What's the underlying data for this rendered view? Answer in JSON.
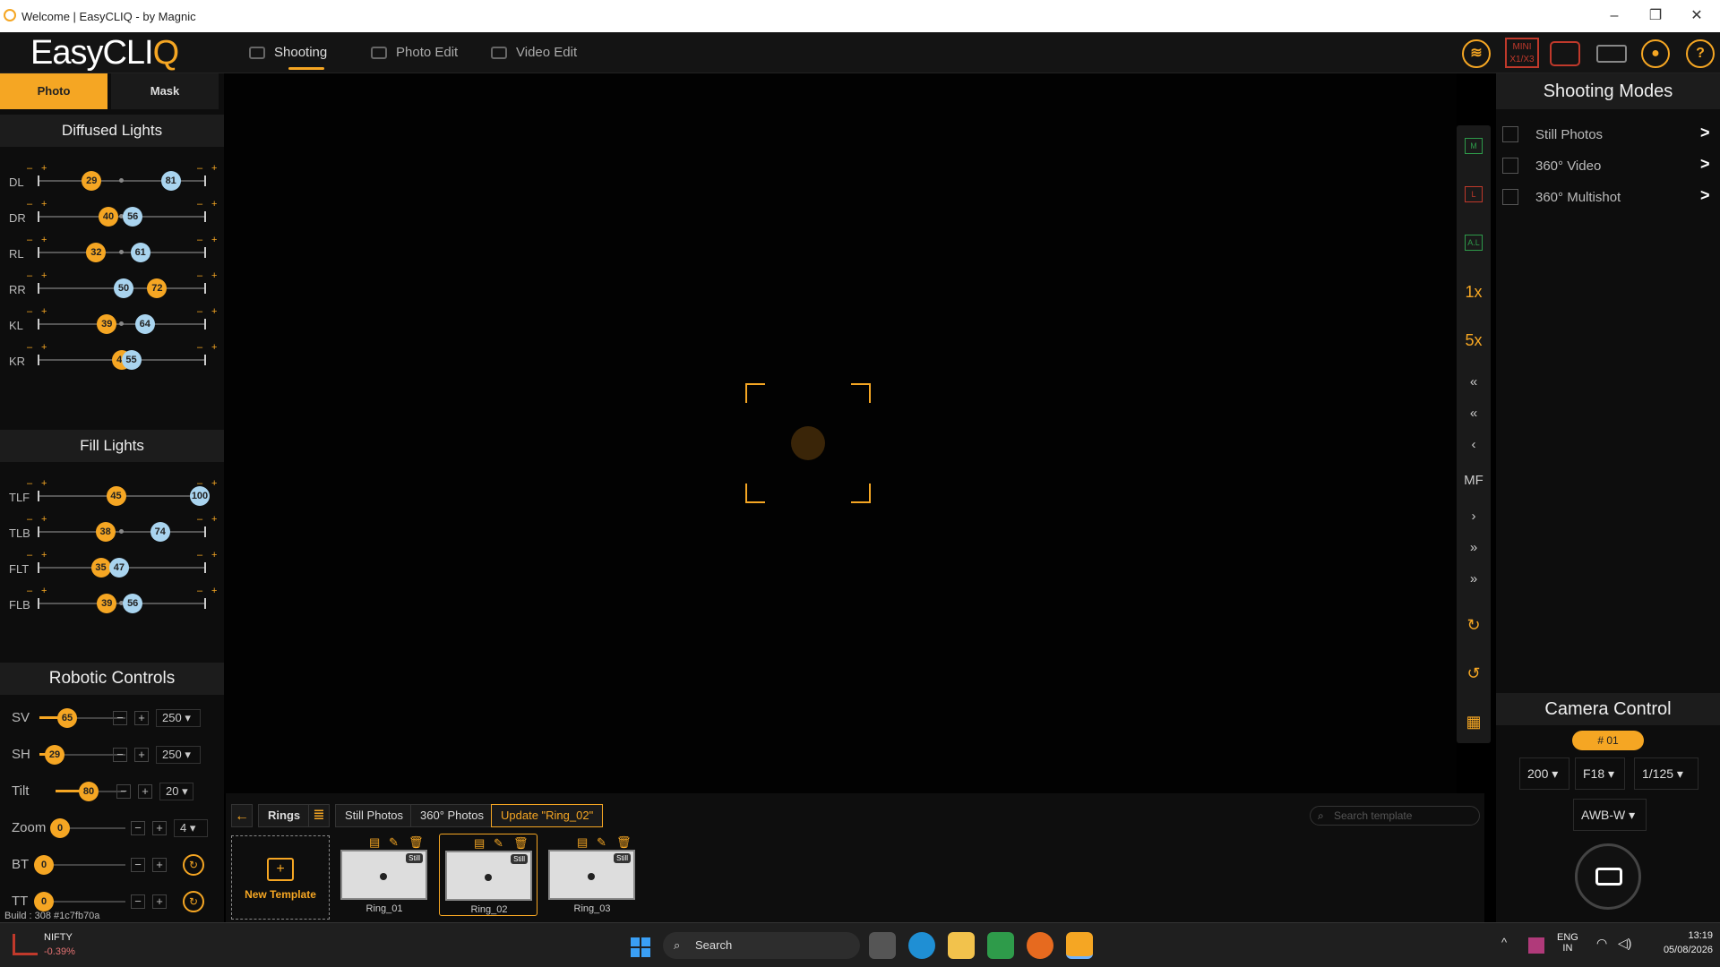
{
  "window": {
    "title": "Welcome | EasyCLIQ - by Magnic",
    "minimize": "–",
    "maximize": "❐",
    "close": "✕"
  },
  "app": {
    "brand_main": "EasyCLI",
    "brand_accent": "Q",
    "tabs": [
      {
        "label": "Shooting"
      },
      {
        "label": "Photo Edit"
      },
      {
        "label": "Video Edit"
      }
    ],
    "top_icons": {
      "device": "MINI X1/X3",
      "help": "?"
    }
  },
  "left": {
    "tabs": {
      "photo": "Photo",
      "mask": "Mask"
    },
    "diffused_title": "Diffused Lights",
    "diffused": [
      {
        "label": "DL",
        "a": 29,
        "b": 81
      },
      {
        "label": "DR",
        "a": 40,
        "b": 56
      },
      {
        "label": "RL",
        "a": 32,
        "b": 61
      },
      {
        "label": "RR",
        "a": 72,
        "b": 50
      },
      {
        "label": "KL",
        "a": 39,
        "b": 64
      },
      {
        "label": "KR",
        "a": 49,
        "b": 55
      }
    ],
    "fill_title": "Fill Lights",
    "fill": [
      {
        "label": "TLF",
        "a": 45,
        "b": 100
      },
      {
        "label": "TLB",
        "a": 38,
        "b": 74
      },
      {
        "label": "FLT",
        "a": 35,
        "b": 47
      },
      {
        "label": "FLB",
        "a": 39,
        "b": 56
      }
    ],
    "robotic_title": "Robotic Controls",
    "robotic": [
      {
        "label": "SV",
        "value": 65,
        "step": "250"
      },
      {
        "label": "SH",
        "value": 29,
        "step": "250"
      },
      {
        "label": "Tilt",
        "value": 80,
        "step": "20"
      },
      {
        "label": "Zoom",
        "value": 0,
        "step": "4"
      },
      {
        "label": "BT",
        "value": 0
      },
      {
        "label": "TT",
        "value": 0
      }
    ],
    "build": "Build : 308 #1c7fb70a"
  },
  "vstrip": [
    "M",
    "L",
    "A.L",
    "1x",
    "5x",
    "«",
    "«",
    "‹",
    "MF",
    "›",
    "»",
    "»",
    "↻",
    "↺",
    "▦"
  ],
  "right": {
    "title": "Shooting Modes",
    "modes": [
      {
        "label": "Still Photos"
      },
      {
        "label": "360° Video"
      },
      {
        "label": "360° Multishot"
      }
    ],
    "camera_title": "Camera Control",
    "cam_id": "# 01",
    "iso": "200",
    "aperture": "F18",
    "shutter": "1/125",
    "wb": "AWB-W"
  },
  "bottom": {
    "folder": "Rings",
    "chips": [
      "Still Photos",
      "360° Photos"
    ],
    "update": "Update \"Ring_02\"",
    "search_placeholder": "Search template",
    "new_template": "New Template",
    "templates": [
      {
        "name": "Ring_01",
        "badge": "Still"
      },
      {
        "name": "Ring_02",
        "badge": "Still"
      },
      {
        "name": "Ring_03",
        "badge": "Still"
      }
    ]
  },
  "taskbar": {
    "ticker": "NIFTY",
    "ticker_change": "-0.39%",
    "search": "Search",
    "lang1": "ENG",
    "lang2": "IN",
    "time": "13:19",
    "date": "05/08/2026"
  },
  "colors": {
    "accent": "#f5a623",
    "knob_blue": "#a9d4ef"
  }
}
